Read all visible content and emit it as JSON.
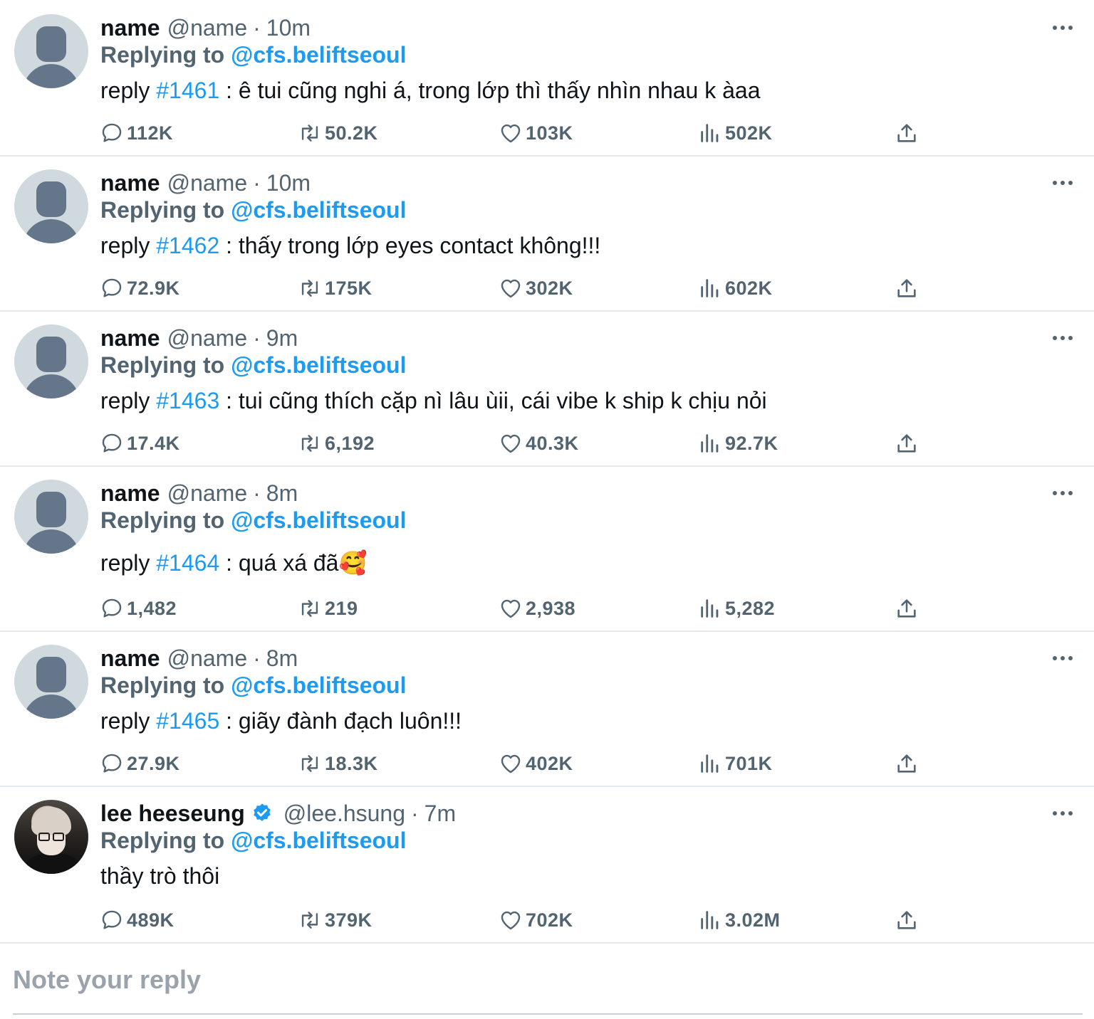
{
  "tweets": [
    {
      "display_name": "name",
      "handle": "@name",
      "separator": "·",
      "time": "10m",
      "replying_label": "Replying to",
      "replying_to": "@cfs.beliftseoul",
      "body_prefix": "reply",
      "body_tag": "#1461",
      "body_text": " : ê tui cũng nghi á, trong lớp thì thấy nhìn nhau k àaa",
      "stats": {
        "replies": "112K",
        "retweets": "50.2K",
        "likes": "103K",
        "views": "502K"
      }
    },
    {
      "display_name": "name",
      "handle": "@name",
      "separator": "·",
      "time": "10m",
      "replying_label": "Replying to",
      "replying_to": "@cfs.beliftseoul",
      "body_prefix": "reply",
      "body_tag": "#1462",
      "body_text": " : thấy trong lớp eyes contact không!!!",
      "stats": {
        "replies": "72.9K",
        "retweets": "175K",
        "likes": "302K",
        "views": "602K"
      }
    },
    {
      "display_name": "name",
      "handle": "@name",
      "separator": "·",
      "time": "9m",
      "replying_label": "Replying to",
      "replying_to": "@cfs.beliftseoul",
      "body_prefix": "reply",
      "body_tag": "#1463",
      "body_text": " : tui cũng thích cặp nì lâu ùii, cái vibe k ship k chịu nỏi",
      "stats": {
        "replies": "17.4K",
        "retweets": "6,192",
        "likes": "40.3K",
        "views": "92.7K"
      }
    },
    {
      "display_name": "name",
      "handle": "@name",
      "separator": "·",
      "time": "8m",
      "replying_label": "Replying to",
      "replying_to": "@cfs.beliftseoul",
      "body_prefix": "reply",
      "body_tag": "#1464",
      "body_text": " : quá xá đã🥰",
      "stats": {
        "replies": "1,482",
        "retweets": "219",
        "likes": "2,938",
        "views": "5,282"
      }
    },
    {
      "display_name": "name",
      "handle": "@name",
      "separator": "·",
      "time": "8m",
      "replying_label": "Replying to",
      "replying_to": "@cfs.beliftseoul",
      "body_prefix": "reply",
      "body_tag": "#1465",
      "body_text": " : giãy đành đạch luôn!!!",
      "stats": {
        "replies": "27.9K",
        "retweets": "18.3K",
        "likes": "402K",
        "views": "701K"
      }
    },
    {
      "display_name": "lee heeseung",
      "handle": "@lee.hsung",
      "separator": "·",
      "time": "7m",
      "verified": true,
      "replying_label": "Replying to",
      "replying_to": "@cfs.beliftseoul",
      "body_text": "thầy trò thôi",
      "stats": {
        "replies": "489K",
        "retweets": "379K",
        "likes": "702K",
        "views": "3.02M"
      }
    }
  ],
  "reply_box": {
    "placeholder": "Note your reply"
  },
  "colors": {
    "accent": "#1d9bf0",
    "muted": "#536471",
    "text": "#0f1419",
    "divider": "#e6e9ec"
  },
  "icons": [
    "more-icon",
    "reply-icon",
    "retweet-icon",
    "like-icon",
    "views-icon",
    "share-icon",
    "verified-badge-icon"
  ]
}
